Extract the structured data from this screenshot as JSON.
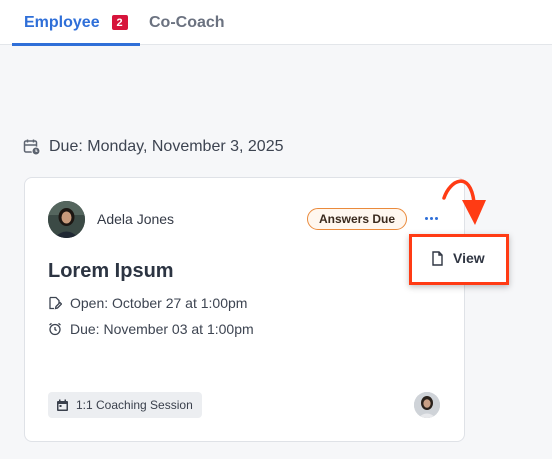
{
  "tabs": {
    "employee": {
      "label": "Employee",
      "badge": "2"
    },
    "cocoach": {
      "label": "Co-Coach"
    }
  },
  "due_heading": "Due: Monday, November 3, 2025",
  "card": {
    "assignee": "Adela Jones",
    "status": "Answers Due",
    "title": "Lorem Ipsum",
    "open": "Open: October 27 at 1:00pm",
    "due": "Due: November 03 at 1:00pm",
    "session_type": "1:1 Coaching Session"
  },
  "menu": {
    "view_label": "View"
  },
  "colors": {
    "accent": "#2f6fd8",
    "badge": "#d7143b",
    "status_border": "#ea8a3c",
    "annotation": "#ff3b14"
  },
  "icons": [
    "calendar-clock-icon",
    "pencil-icon",
    "alarm-clock-icon",
    "calendar-icon",
    "document-icon",
    "more-icon",
    "red-arrow-annotation"
  ]
}
